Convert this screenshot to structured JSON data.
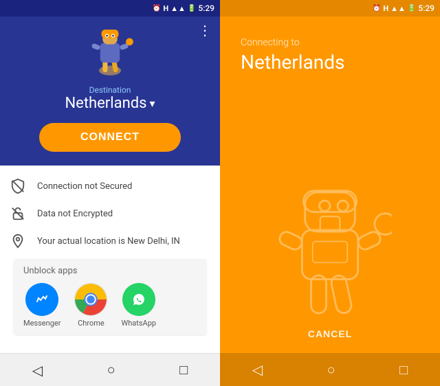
{
  "left": {
    "statusBar": {
      "time": "5:29",
      "icons": [
        "alarm",
        "H",
        "signal",
        "wifi",
        "battery"
      ]
    },
    "hero": {
      "destinationLabel": "Destination",
      "destinationName": "Netherlands",
      "connectButton": "CONNECT",
      "menuDots": "⋮"
    },
    "statusItems": [
      {
        "id": "no-shield",
        "text": "Connection not Secured"
      },
      {
        "id": "no-lock",
        "text": "Data not Encrypted"
      },
      {
        "id": "location",
        "text": "Your actual location is New Delhi, IN"
      }
    ],
    "unblockSection": {
      "title": "Unblock apps",
      "apps": [
        {
          "name": "Messenger",
          "icon": "messenger"
        },
        {
          "name": "Chrome",
          "icon": "chrome"
        },
        {
          "name": "WhatsApp",
          "icon": "whatsapp"
        }
      ]
    },
    "navBar": {
      "back": "◁",
      "home": "○",
      "recent": "□"
    }
  },
  "right": {
    "statusBar": {
      "time": "5:29"
    },
    "connectingLabel": "Connecting to",
    "countryName": "Netherlands",
    "cancelButton": "CANCEL",
    "navBar": {
      "back": "◁",
      "home": "○",
      "recent": "□"
    }
  }
}
